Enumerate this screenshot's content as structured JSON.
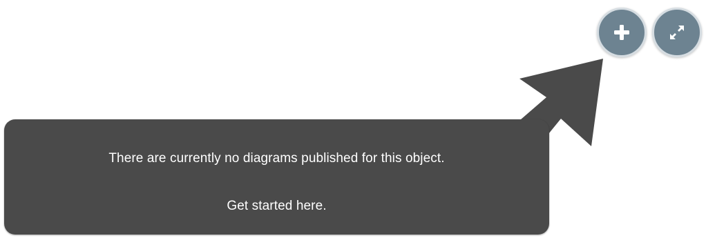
{
  "toolbar": {
    "add_button": {
      "icon": "plus-icon"
    },
    "expand_button": {
      "icon": "expand-diagonal-icon"
    },
    "button_color": "#6d8391",
    "button_border_color": "#d6dde2"
  },
  "callout": {
    "message": "There are currently no diagrams published for this object.",
    "cta": "Get started here.",
    "background_color": "#4a4a4a",
    "text_color": "#ffffff"
  }
}
